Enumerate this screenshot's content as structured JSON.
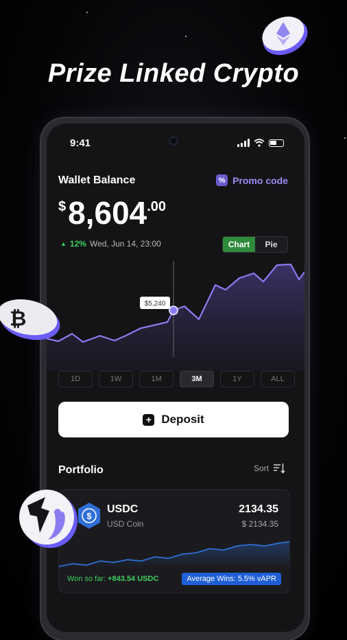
{
  "headline": "Prize Linked Crypto",
  "status": {
    "time": "9:41"
  },
  "wallet": {
    "title": "Wallet Balance",
    "promo_label": "Promo code",
    "currency": "$",
    "balance_main": "8,604",
    "balance_decimal": ".00",
    "change_pct": "12%",
    "change_date": "Wed, Jun 14, 23:00"
  },
  "chart_toggle": {
    "chart": "Chart",
    "pie": "Pie"
  },
  "chart_tooltip": "$5,240",
  "ranges": [
    "1D",
    "1W",
    "1M",
    "3M",
    "1Y",
    "ALL"
  ],
  "selected_range": "3M",
  "deposit_label": "Deposit",
  "portfolio": {
    "title": "Portfolio",
    "sort_label": "Sort",
    "items": [
      {
        "symbol": "USDC",
        "name": "USD Coin",
        "amount": "2134.35",
        "amount_usd": "$ 2134.35",
        "won_label": "Won so far:",
        "won_value": "+843.54 USDC",
        "avg_label": "Average Wins: 5.5% vAPR"
      }
    ]
  },
  "colors": {
    "accent_purple": "#8a7cf0",
    "green": "#3ecf5e",
    "blue": "#1f5fd6"
  },
  "icons": [
    "ethereum-coin-icon",
    "bitcoin-coin-icon",
    "app-logo-coin-icon",
    "usdc-icon",
    "promo-percent-icon",
    "plus-icon",
    "sort-icon",
    "signal-icon",
    "wifi-icon",
    "battery-icon"
  ]
}
